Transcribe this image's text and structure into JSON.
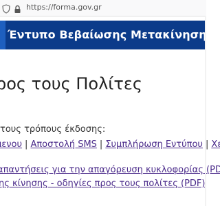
{
  "browser": {
    "url": "https://forma.gov.gr"
  },
  "header": {
    "title": "Έντυπο Βεβαίωσης Μετακίνησης"
  },
  "main": {
    "heading": "ρος τους Πολίτες",
    "ways_text": "τους τρόπους έκδοσης:",
    "methods": [
      {
        "label": "μενου"
      },
      {
        "label": "Αποστολή SMS"
      },
      {
        "label": "Συμπλήρωση Εντύπου"
      },
      {
        "label": "Χε"
      }
    ],
    "documents": [
      {
        "label": "απαντήσεις για την απαγόρευση κυκλοφορίας (PDF)"
      },
      {
        "label": "ης κίνησης - οδηγίες προς τους πολίτες (PDF)"
      }
    ]
  },
  "colors": {
    "header_bg": "#0b3b8a",
    "link": "#4a2a8a"
  }
}
